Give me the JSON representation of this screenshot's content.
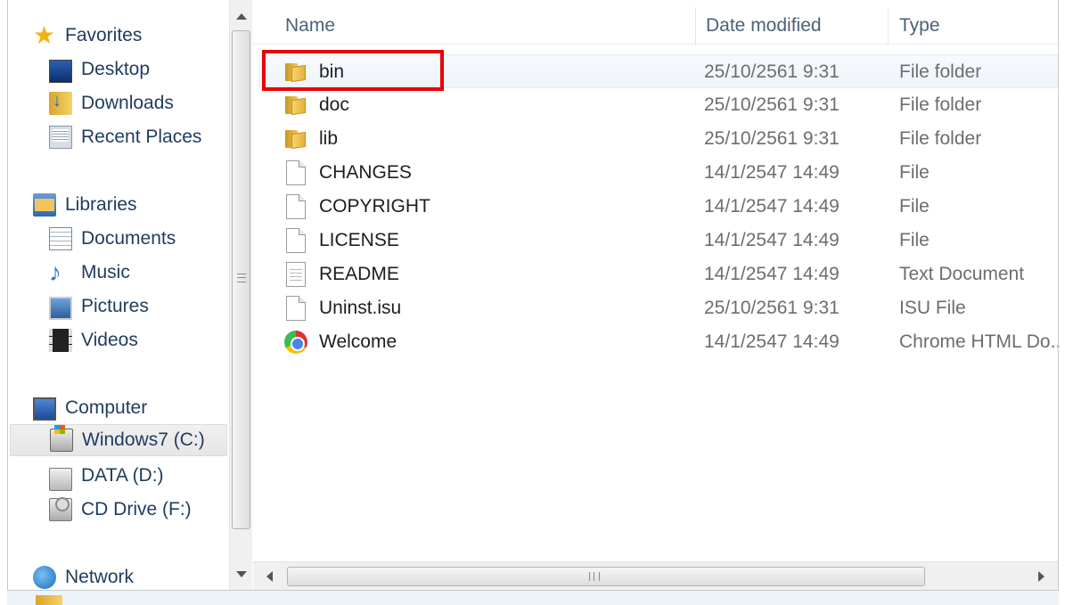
{
  "nav": {
    "favorites": {
      "label": "Favorites",
      "items": [
        {
          "label": "Desktop",
          "icon": "desktop-icon"
        },
        {
          "label": "Downloads",
          "icon": "downloads-icon"
        },
        {
          "label": "Recent Places",
          "icon": "recent-places-icon"
        }
      ]
    },
    "libraries": {
      "label": "Libraries",
      "items": [
        {
          "label": "Documents",
          "icon": "documents-icon"
        },
        {
          "label": "Music",
          "icon": "music-icon"
        },
        {
          "label": "Pictures",
          "icon": "pictures-icon"
        },
        {
          "label": "Videos",
          "icon": "videos-icon"
        }
      ]
    },
    "computer": {
      "label": "Computer",
      "items": [
        {
          "label": "Windows7 (C:)",
          "icon": "windows-drive-icon",
          "selected": true
        },
        {
          "label": "DATA (D:)",
          "icon": "drive-icon"
        },
        {
          "label": "CD Drive (F:)",
          "icon": "cd-drive-icon"
        }
      ]
    },
    "network": {
      "label": "Network",
      "icon": "network-icon"
    }
  },
  "columns": {
    "name": "Name",
    "date": "Date modified",
    "type": "Type"
  },
  "files": [
    {
      "name": "bin",
      "date": "25/10/2561 9:31",
      "type": "File folder",
      "icon": "folder-icon"
    },
    {
      "name": "doc",
      "date": "25/10/2561 9:31",
      "type": "File folder",
      "icon": "folder-icon"
    },
    {
      "name": "lib",
      "date": "25/10/2561 9:31",
      "type": "File folder",
      "icon": "folder-icon"
    },
    {
      "name": "CHANGES",
      "date": "14/1/2547 14:49",
      "type": "File",
      "icon": "file-icon"
    },
    {
      "name": "COPYRIGHT",
      "date": "14/1/2547 14:49",
      "type": "File",
      "icon": "file-icon"
    },
    {
      "name": "LICENSE",
      "date": "14/1/2547 14:49",
      "type": "File",
      "icon": "file-icon"
    },
    {
      "name": "README",
      "date": "14/1/2547 14:49",
      "type": "Text Document",
      "icon": "text-document-icon"
    },
    {
      "name": "Uninst.isu",
      "date": "25/10/2561 9:31",
      "type": "ISU File",
      "icon": "file-icon"
    },
    {
      "name": "Welcome",
      "date": "14/1/2547 14:49",
      "type": "Chrome HTML Do...",
      "icon": "chrome-icon"
    }
  ],
  "highlight": {
    "target": "bin",
    "color": "#e8000b"
  }
}
